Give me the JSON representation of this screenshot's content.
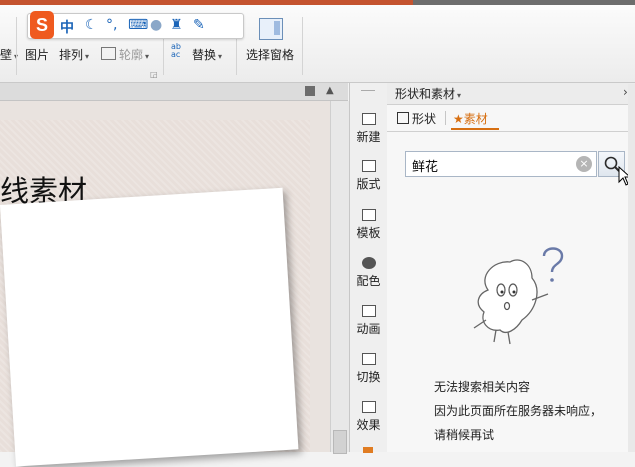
{
  "ime": {
    "logo": "S",
    "mode": "中"
  },
  "ribbon": {
    "shape_tail": "壁",
    "picture": "图片",
    "arrange": "排列",
    "outline": "轮廓",
    "replace": "替换",
    "selection_pane": "选择窗格"
  },
  "slide": {
    "title_fragment": "线素材"
  },
  "side_tools": [
    {
      "label": "新建"
    },
    {
      "label": "版式"
    },
    {
      "label": "模板"
    },
    {
      "label": "配色"
    },
    {
      "label": "动画"
    },
    {
      "label": "切换"
    },
    {
      "label": "效果"
    }
  ],
  "pane": {
    "title": "形状和素材",
    "tabs": {
      "shapes": "形状",
      "materials": "素材"
    },
    "search": {
      "value": "鲜花"
    },
    "message": {
      "line1": "无法搜索相关内容",
      "line2": "因为此页面所在服务器未响应，",
      "line3": "请稍候再试"
    }
  },
  "colors": {
    "accent": "#d76f12",
    "ime_logo": "#ef5a1f",
    "title_bar": "#c4532f"
  }
}
